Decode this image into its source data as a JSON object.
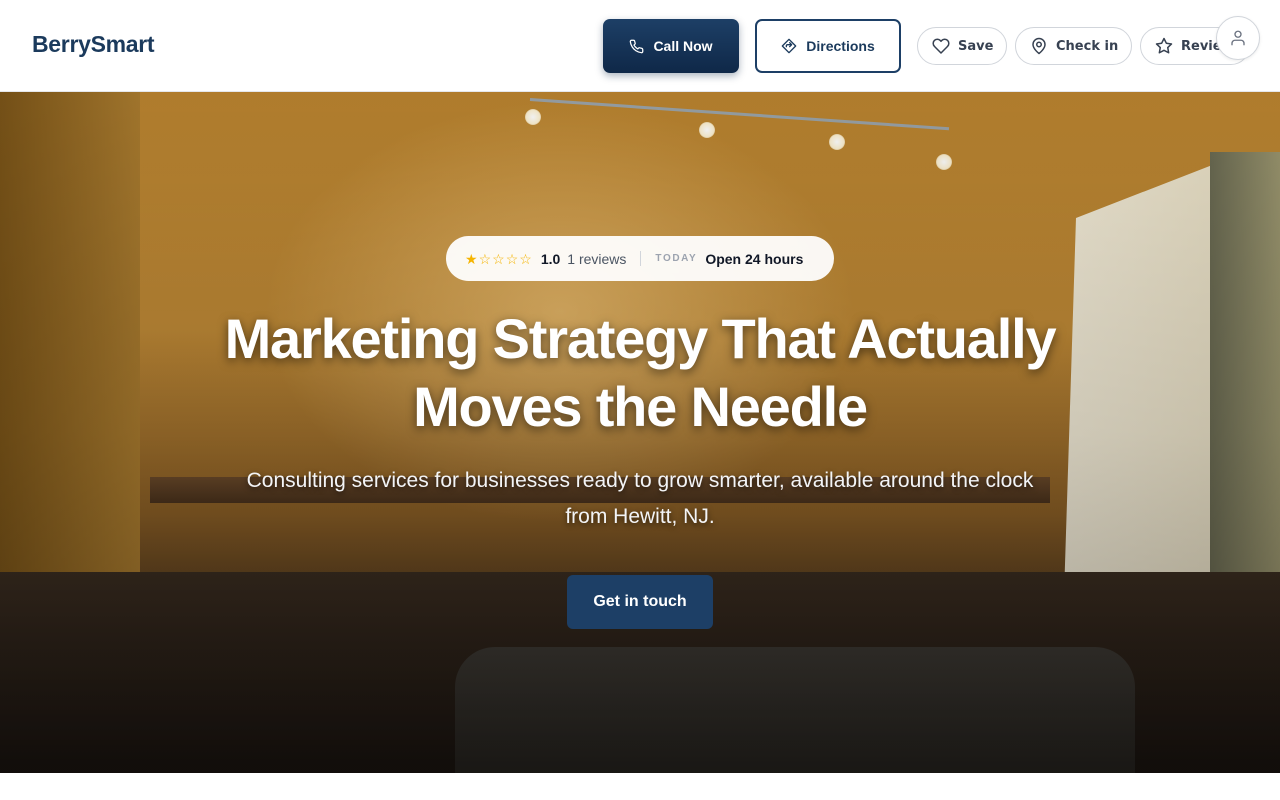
{
  "header": {
    "brand": "BerrySmart",
    "call_label": "Call Now",
    "directions_label": "Directions",
    "save_label": "Save",
    "checkin_label": "Check in",
    "review_label": "Review"
  },
  "hero": {
    "rating": {
      "stars_filled": 1,
      "stars_total": 5,
      "value": "1.0",
      "reviews": "1 reviews",
      "today_label": "TODAY",
      "hours": "Open 24 hours"
    },
    "headline_line1": "Marketing Strategy That Actually",
    "headline_line2": "Moves the Needle",
    "subtitle": "Consulting services for businesses ready to grow smarter, available around the clock from Hewitt, NJ.",
    "cta_label": "Get in touch"
  },
  "icons": {
    "call": "phone-icon",
    "directions": "directions-icon",
    "save": "heart-icon",
    "checkin": "map-pin-icon",
    "review": "star-icon",
    "account": "user-icon"
  },
  "colors": {
    "brand": "#1b3a5c",
    "primary": "#1d3f66",
    "star": "#f5b400"
  }
}
